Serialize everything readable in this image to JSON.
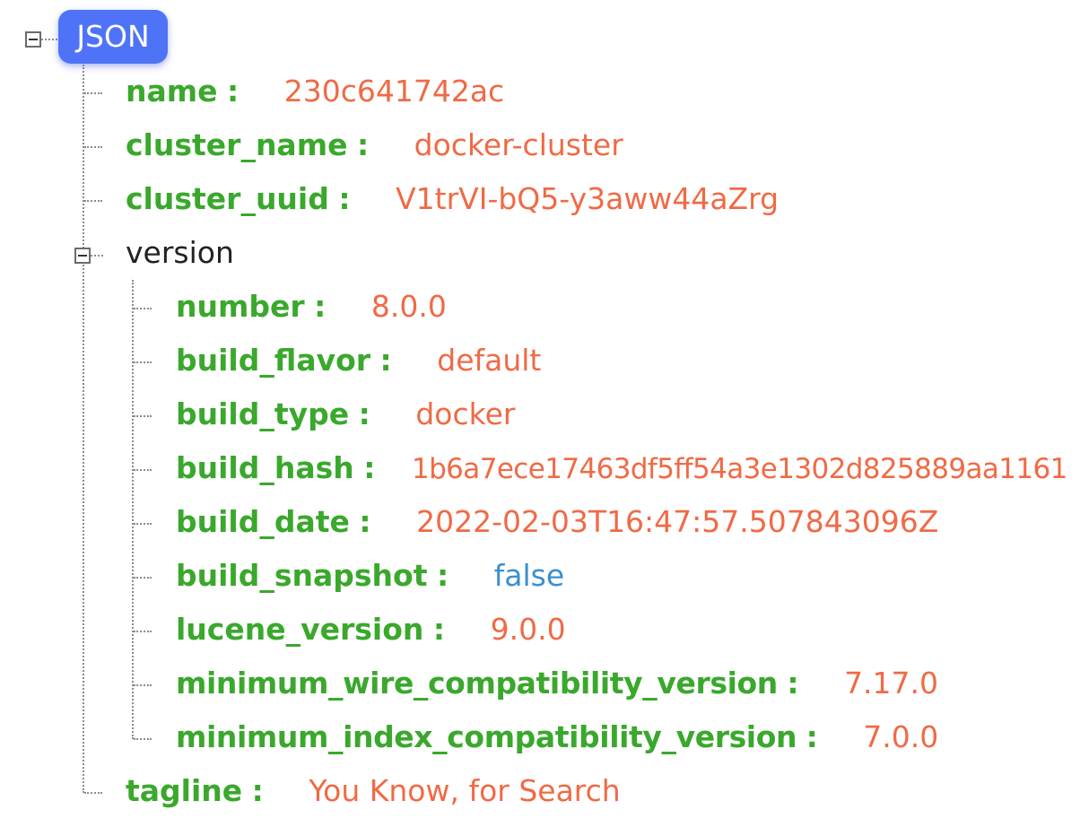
{
  "root": {
    "label": "JSON"
  },
  "top_fields": [
    {
      "key": "name",
      "value": "230c641742ac",
      "type": "string"
    },
    {
      "key": "cluster_name",
      "value": "docker-cluster",
      "type": "string"
    },
    {
      "key": "cluster_uuid",
      "value": "V1trVI-bQ5-y3aww44aZrg",
      "type": "string"
    }
  ],
  "version": {
    "key": "version",
    "fields": [
      {
        "key": "number",
        "value": "8.0.0",
        "type": "string"
      },
      {
        "key": "build_flavor",
        "value": "default",
        "type": "string"
      },
      {
        "key": "build_type",
        "value": "docker",
        "type": "string"
      },
      {
        "key": "build_hash",
        "value": "1b6a7ece17463df5ff54a3e1302d825889aa1161",
        "type": "string"
      },
      {
        "key": "build_date",
        "value": "2022-02-03T16:47:57.507843096Z",
        "type": "string"
      },
      {
        "key": "build_snapshot",
        "value": "false",
        "type": "boolean"
      },
      {
        "key": "lucene_version",
        "value": "9.0.0",
        "type": "string"
      },
      {
        "key": "minimum_wire_compatibility_version",
        "value": "7.17.0",
        "type": "string"
      },
      {
        "key": "minimum_index_compatibility_version",
        "value": "7.0.0",
        "type": "string"
      }
    ]
  },
  "tagline": {
    "key": "tagline",
    "value": "You Know, for Search",
    "type": "string"
  },
  "labels": {
    "colon": ":"
  },
  "colors": {
    "key": "#3aa82c",
    "string_value": "#f06a45",
    "boolean_value": "#3b8fd0",
    "root_badge": "#4f73f7"
  },
  "icons": {
    "collapse": "minus-box-icon"
  }
}
